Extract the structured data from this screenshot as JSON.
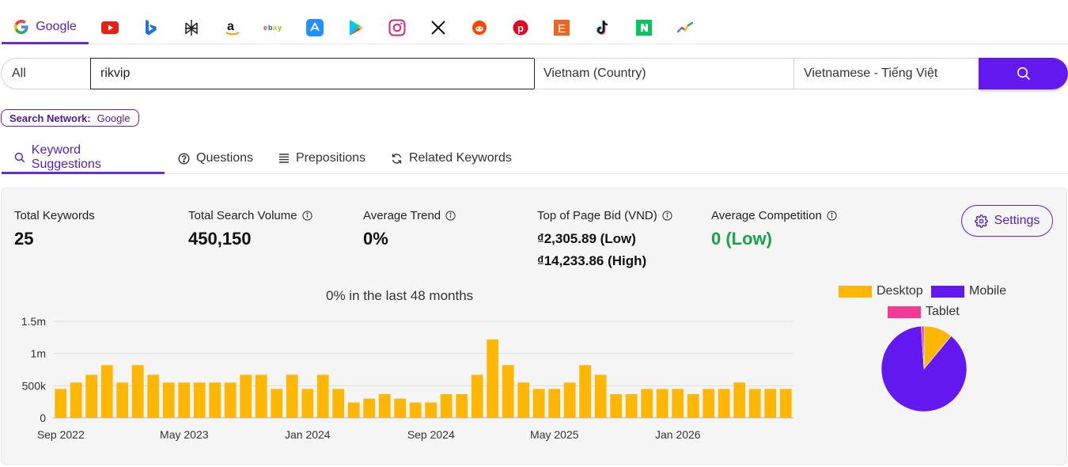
{
  "networks": [
    {
      "name": "Google",
      "icon": "google-icon",
      "active": true
    },
    {
      "icon": "youtube-icon"
    },
    {
      "icon": "bing-icon"
    },
    {
      "icon": "perplexity-icon"
    },
    {
      "icon": "amazon-icon"
    },
    {
      "icon": "ebay-icon"
    },
    {
      "icon": "app-store-icon"
    },
    {
      "icon": "google-play-icon"
    },
    {
      "icon": "instagram-icon"
    },
    {
      "icon": "x-icon"
    },
    {
      "icon": "reddit-icon"
    },
    {
      "icon": "pinterest-icon"
    },
    {
      "icon": "etsy-icon"
    },
    {
      "icon": "tiktok-icon"
    },
    {
      "icon": "naver-icon"
    },
    {
      "icon": "trends-icon"
    }
  ],
  "search": {
    "scope": "All",
    "query": "rikvip",
    "country": "Vietnam (Country)",
    "language": "Vietnamese - Tiếng Việt"
  },
  "badge": {
    "label": "Search Network:",
    "value": "Google"
  },
  "tabs": [
    "Keyword Suggestions",
    "Questions",
    "Prepositions",
    "Related Keywords"
  ],
  "stats": {
    "total_keywords_label": "Total Keywords",
    "total_keywords": "25",
    "volume_label": "Total Search Volume",
    "volume": "450,150",
    "trend_label": "Average Trend",
    "trend": "0%",
    "bid_label": "Top of Page Bid (VND)",
    "bid_low": "₫2,305.89 (Low)",
    "bid_high": "₫14,233.86 (High)",
    "competition_label": "Average Competition",
    "competition": "0 (Low)",
    "competition_color": "#16a34a"
  },
  "settings_label": "Settings",
  "colors": {
    "accent": "#6418f0",
    "bar": "#ffb703",
    "desktop": "#ffb703",
    "mobile": "#6418f0",
    "tablet": "#f03c96"
  },
  "chart_data": [
    {
      "type": "bar",
      "title": "0% in the last 48 months",
      "x_tick_labels": [
        "Sep 2022",
        "May 2023",
        "Jan 2024",
        "Sep 2024",
        "May 2025",
        "Jan 2026"
      ],
      "y_tick_labels": [
        "0",
        "500k",
        "1m",
        "1.5m"
      ],
      "ylim": [
        0,
        1500000
      ],
      "values": [
        450000,
        550000,
        670000,
        820000,
        550000,
        820000,
        670000,
        550000,
        550000,
        550000,
        550000,
        550000,
        670000,
        670000,
        450000,
        670000,
        450000,
        670000,
        450000,
        240000,
        300000,
        370000,
        300000,
        240000,
        240000,
        370000,
        370000,
        670000,
        1220000,
        820000,
        550000,
        450000,
        450000,
        550000,
        820000,
        670000,
        370000,
        370000,
        450000,
        450000,
        450000,
        370000,
        450000,
        450000,
        550000,
        450000,
        450000,
        450000
      ]
    },
    {
      "type": "pie",
      "labels": [
        "Desktop",
        "Mobile",
        "Tablet"
      ],
      "values": [
        11,
        88,
        1
      ]
    }
  ]
}
